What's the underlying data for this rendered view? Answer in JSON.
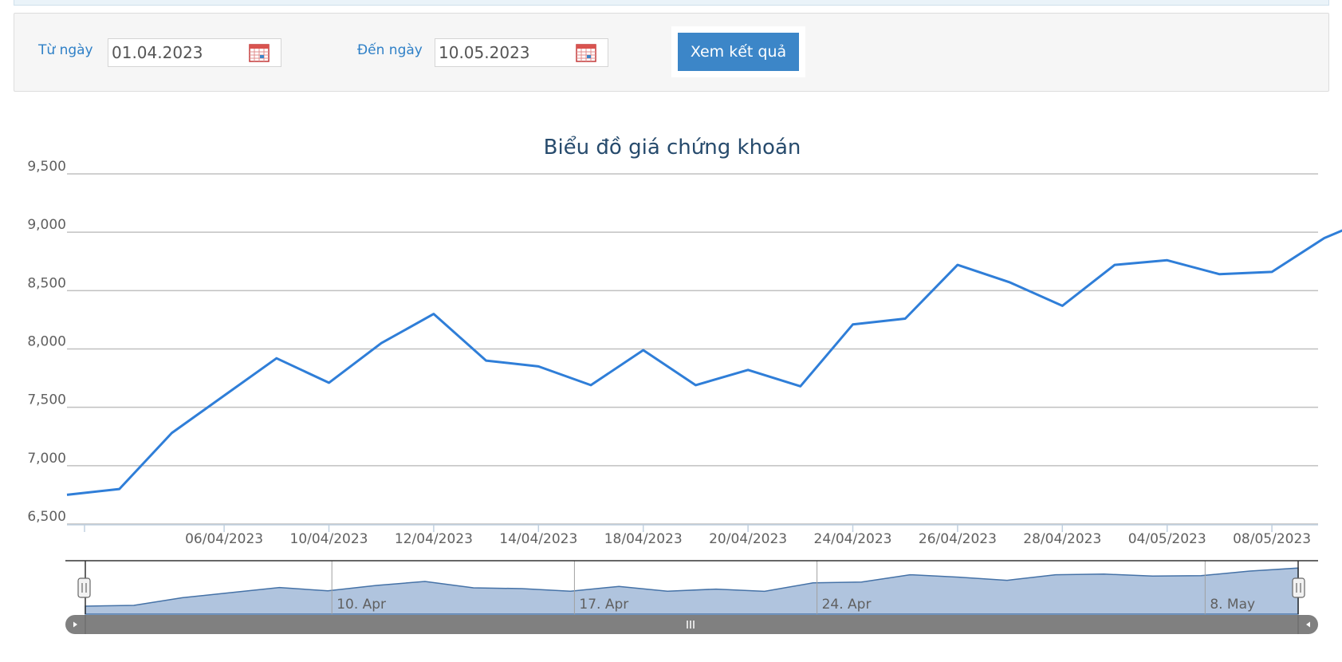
{
  "filter": {
    "from_label": "Từ ngày",
    "from_value": "01.04.2023",
    "to_label": "Đến ngày",
    "to_value": "10.05.2023",
    "submit_label": "Xem kết quả"
  },
  "colors": {
    "line": "#2f7ed8",
    "navigator_fill": "#b0c4de",
    "navigator_line": "#4572a7",
    "title": "#274b6d",
    "link": "#2f80c7",
    "button": "#3c86c8"
  },
  "chart_data": {
    "type": "line",
    "title": "Biểu đồ giá chứng khoán",
    "ylim": [
      6500,
      9500
    ],
    "yticks": [
      "6,500",
      "7,000",
      "7,500",
      "8,000",
      "8,500",
      "9,000",
      "9,500"
    ],
    "grid": true,
    "x": [
      "03/04/2023",
      "04/04/2023",
      "05/04/2023",
      "06/04/2023",
      "07/04/2023",
      "10/04/2023",
      "11/04/2023",
      "12/04/2023",
      "13/04/2023",
      "14/04/2023",
      "17/04/2023",
      "18/04/2023",
      "19/04/2023",
      "20/04/2023",
      "21/04/2023",
      "24/04/2023",
      "25/04/2023",
      "26/04/2023",
      "27/04/2023",
      "28/04/2023",
      "03/05/2023",
      "04/05/2023",
      "05/05/2023",
      "08/05/2023",
      "09/05/2023",
      "10/05/2023"
    ],
    "series": [
      {
        "values": [
          6750,
          6800,
          7280,
          7600,
          7920,
          7710,
          8050,
          8300,
          7900,
          7850,
          7690,
          7990,
          7690,
          7820,
          7680,
          8210,
          8260,
          8720,
          8570,
          8370,
          8720,
          8760,
          8640,
          8660,
          8950,
          9140
        ]
      }
    ],
    "xtick_labels": [
      "06/04/2023",
      "10/04/2023",
      "12/04/2023",
      "14/04/2023",
      "18/04/2023",
      "20/04/2023",
      "24/04/2023",
      "26/04/2023",
      "28/04/2023",
      "04/05/2023",
      "08/05/2023"
    ],
    "navigator_labels": [
      "10. Apr",
      "17. Apr",
      "24. Apr",
      "8. May"
    ]
  }
}
